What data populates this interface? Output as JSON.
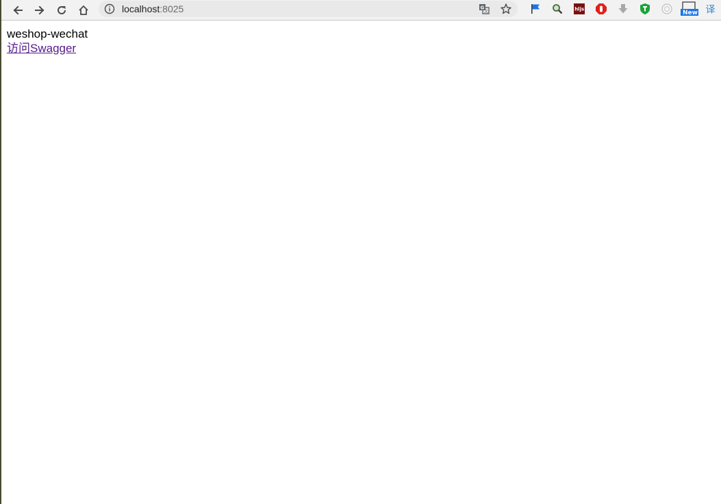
{
  "browser": {
    "url_host": "localhost",
    "url_port": ":8025",
    "icons": {
      "back": "arrow-left-icon",
      "forward": "arrow-right-icon",
      "reload": "reload-icon",
      "home": "home-icon",
      "info": "info-icon",
      "translate": "translate-icon",
      "bookmark": "star-icon"
    },
    "extensions": [
      {
        "name": "flag-extension-icon",
        "color": "#1a73e8"
      },
      {
        "name": "magnifier-extension-icon",
        "color": "#4a7a3a"
      },
      {
        "name": "hljs-extension-icon",
        "label": "hljs",
        "color": "#7a1010"
      },
      {
        "name": "adblock-extension-icon",
        "color": "#e0201a"
      },
      {
        "name": "download-extension-icon",
        "color": "#a0a0a0"
      },
      {
        "name": "shield-extension-icon",
        "color": "#1aa33a"
      },
      {
        "name": "circle-extension-icon",
        "color": "#c8c8c8"
      },
      {
        "name": "new-extension-icon",
        "label": "New",
        "color": "#1a73e8"
      },
      {
        "name": "translate-extension-icon",
        "label": "译",
        "color": "#3a86d8"
      }
    ]
  },
  "page": {
    "title": "weshop-wechat",
    "link_text": "访问Swagger"
  }
}
